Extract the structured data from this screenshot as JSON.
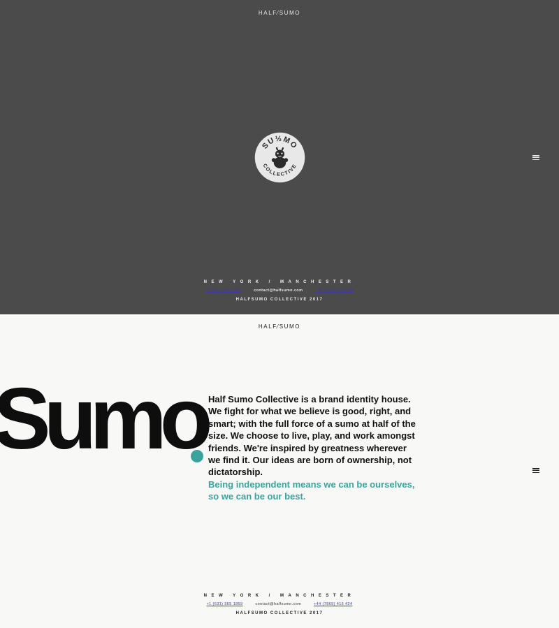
{
  "brand": {
    "logo_text": "HALF⁄SUMO",
    "badge_top_text": "SU½MO",
    "badge_bottom_text": "COLLECTIVE"
  },
  "footer": {
    "cities": "NEW YORK / MANCHESTER",
    "phone_us": "+1 (631) 565 1859",
    "email": "contact@halfsumo.com",
    "phone_uk": "+44 (7869) 415 424",
    "copyright": "HALFSUMO COLLECTIVE 2017"
  },
  "about": {
    "big_word": "Sumo",
    "paragraph": "Half Sumo Collective is a brand identity house. We fight for what we believe is good, right, and smart; with the full force of a sumo at half of the size. We choose to live, play, and work amongst friends. We're inspired by greatness wherever we find it. Our ideas are born of ownership, not dictatorship.",
    "highlight": "Being independent means we can be ourselves, so we can be our best."
  },
  "colors": {
    "hero_bg": "#4b4b4b",
    "page_bg": "#f8f8f6",
    "accent": "#3aa39d",
    "link": "#3a39a6"
  },
  "icons": [
    "menu-icon",
    "badge-logo-icon"
  ]
}
